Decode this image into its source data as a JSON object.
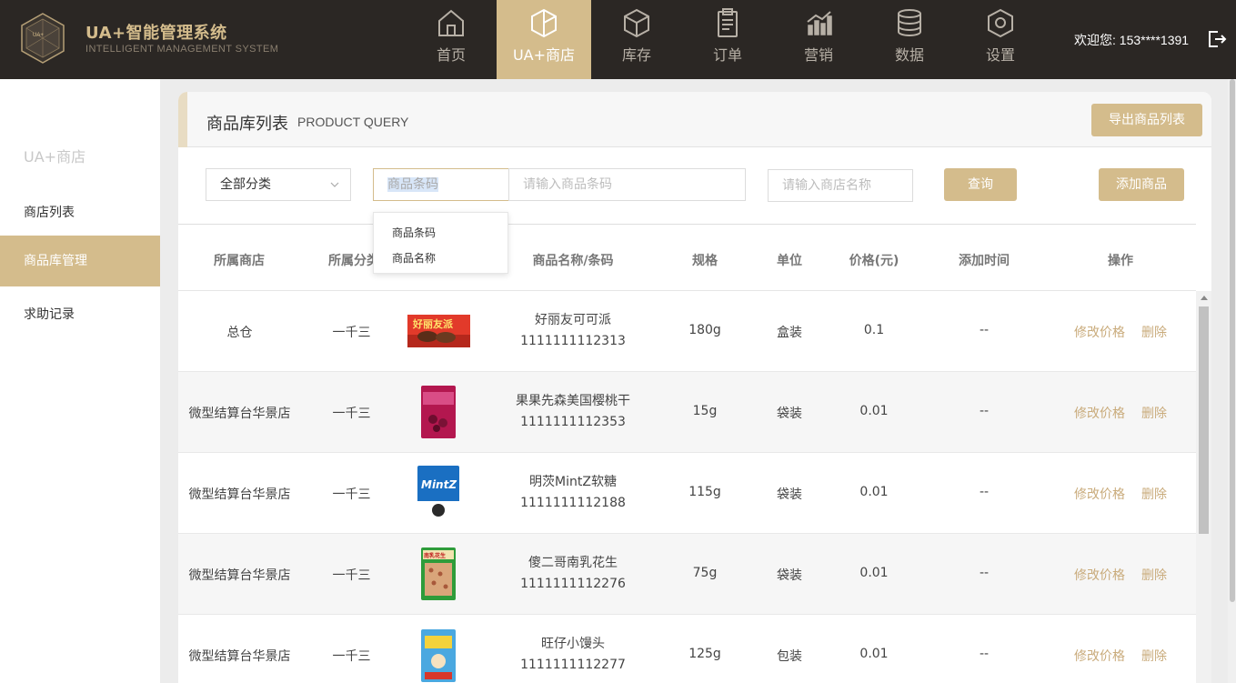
{
  "brand": {
    "title": "UA+智能管理系统",
    "subtitle": "INTELLIGENT MANAGEMENT SYSTEM"
  },
  "nav": [
    {
      "label": "首页",
      "icon": "home-icon"
    },
    {
      "label": "UA+商店",
      "icon": "store-cube-icon",
      "active": true
    },
    {
      "label": "库存",
      "icon": "box-icon"
    },
    {
      "label": "订单",
      "icon": "clipboard-icon"
    },
    {
      "label": "营销",
      "icon": "chart-icon"
    },
    {
      "label": "数据",
      "icon": "database-icon"
    },
    {
      "label": "设置",
      "icon": "settings-icon"
    }
  ],
  "user": {
    "welcome": "欢迎您: 153****1391"
  },
  "sidebar": {
    "heading": "UA+商店",
    "items": [
      {
        "label": "商店列表"
      },
      {
        "label": "商品库管理",
        "active": true
      },
      {
        "label": "求助记录"
      }
    ]
  },
  "panel": {
    "title": "商品库列表",
    "title_en": "PRODUCT QUERY",
    "export_button": "导出商品列表"
  },
  "filters": {
    "category": "全部分类",
    "search_type": "商品条码",
    "barcode_placeholder": "请输入商品条码",
    "store_placeholder": "请输入商店名称",
    "query_button": "查询",
    "add_button": "添加商品",
    "dropdown_options": [
      "商品条码",
      "商品名称"
    ]
  },
  "table": {
    "columns": [
      "所属商店",
      "所属分类",
      "商品名称/条码",
      "规格",
      "单位",
      "价格(元)",
      "添加时间",
      "操作"
    ],
    "action_edit": "修改价格",
    "action_delete": "删除",
    "rows": [
      {
        "store": "总仓",
        "category": "一千三",
        "name": "好丽友可可派",
        "barcode": "1111111112313",
        "spec": "180g",
        "unit": "盒装",
        "price": "0.1",
        "time": "--",
        "image_label": "好丽友派"
      },
      {
        "store": "微型结算台华景店",
        "category": "一千三",
        "name": "果果先森美国樱桃干",
        "barcode": "1111111112353",
        "spec": "15g",
        "unit": "袋装",
        "price": "0.01",
        "time": "--",
        "image_label": ""
      },
      {
        "store": "微型结算台华景店",
        "category": "一千三",
        "name": "明茨MintZ软糖",
        "barcode": "1111111112188",
        "spec": "115g",
        "unit": "袋装",
        "price": "0.01",
        "time": "--",
        "image_label": "MintZ"
      },
      {
        "store": "微型结算台华景店",
        "category": "一千三",
        "name": "傻二哥南乳花生",
        "barcode": "1111111112276",
        "spec": "75g",
        "unit": "袋装",
        "price": "0.01",
        "time": "--",
        "image_label": "南乳花生"
      },
      {
        "store": "微型结算台华景店",
        "category": "一千三",
        "name": "旺仔小馒头",
        "barcode": "1111111112277",
        "spec": "125g",
        "unit": "包装",
        "price": "0.01",
        "time": "--",
        "image_label": ""
      }
    ]
  },
  "colors": {
    "gold": "#d4bc8c",
    "topbar": "#2b2724",
    "link": "#c9ab7b"
  }
}
